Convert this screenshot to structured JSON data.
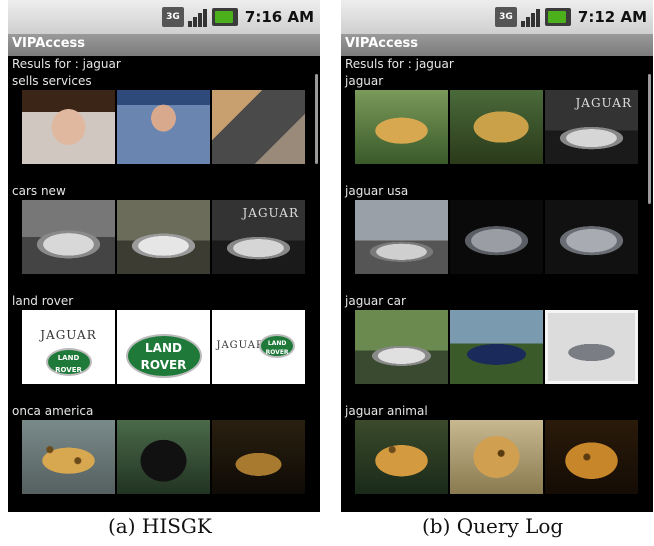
{
  "panels": [
    {
      "status_time": "7:16 AM",
      "network_label": "3G",
      "app_title": "VIPAccess",
      "results_label": "Resuls for : jaguar",
      "categories": [
        {
          "label": "sells  services"
        },
        {
          "label": "cars  new"
        },
        {
          "label": "land  rover"
        },
        {
          "label": "onca  america"
        }
      ],
      "caption": "(a) HISGK"
    },
    {
      "status_time": "7:12 AM",
      "network_label": "3G",
      "app_title": "VIPAccess",
      "results_label": "Resuls for : jaguar",
      "categories": [
        {
          "label": "jaguar"
        },
        {
          "label": "jaguar usa"
        },
        {
          "label": "jaguar car"
        },
        {
          "label": "jaguar animal"
        }
      ],
      "caption": "(b) Query Log"
    }
  ],
  "logos": {
    "jaguar_word": "JAGUAR",
    "land": "LAND",
    "rover": "ROVER"
  },
  "colors": {
    "screen_bg": "#000000",
    "status_bar": "#dcdcdc",
    "app_bar": "#8a8a8a",
    "text": "#e6e6e6"
  }
}
